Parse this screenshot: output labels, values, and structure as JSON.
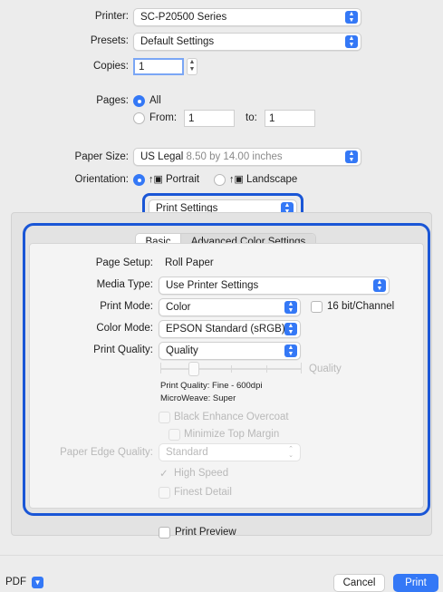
{
  "printer": {
    "label": "Printer:",
    "value": "SC-P20500 Series"
  },
  "presets": {
    "label": "Presets:",
    "value": "Default Settings"
  },
  "copies": {
    "label": "Copies:",
    "value": "1"
  },
  "pages": {
    "label": "Pages:",
    "all_label": "All",
    "from_label": "From:",
    "from_value": "1",
    "to_label": "to:",
    "to_value": "1"
  },
  "paper_size": {
    "label": "Paper Size:",
    "value_bold": "US Legal",
    "value_dim": "8.50 by 14.00 inches"
  },
  "orientation": {
    "label": "Orientation:",
    "portrait": "Portrait",
    "landscape": "Landscape"
  },
  "panel_popup": {
    "value": "Print Settings"
  },
  "tabs": [
    "Basic",
    "Advanced Color Settings"
  ],
  "settings": {
    "page_setup_label": "Page Setup:",
    "page_setup_value": "Roll Paper",
    "media_type_label": "Media Type:",
    "media_type_value": "Use Printer Settings",
    "print_mode_label": "Print Mode:",
    "print_mode_value": "Color",
    "bit_label": "16 bit/Channel",
    "color_mode_label": "Color Mode:",
    "color_mode_value": "EPSON Standard (sRGB)",
    "print_quality_label": "Print Quality:",
    "print_quality_value": "Quality",
    "slider_label": "Quality",
    "slider_level": 0.2,
    "info_line1": "Print Quality: Fine - 600dpi",
    "info_line2": "MicroWeave: Super",
    "black_enhance": "Black Enhance Overcoat",
    "minimize_margin": "Minimize Top Margin",
    "edge_quality_label": "Paper Edge Quality:",
    "edge_quality_value": "Standard",
    "high_speed": "High Speed",
    "finest_detail": "Finest Detail"
  },
  "print_preview": "Print Preview",
  "footer": {
    "pdf": "PDF",
    "cancel": "Cancel",
    "print": "Print"
  },
  "colors": {
    "accent": "#3478f6",
    "highlight_outline": "#1a56d6"
  }
}
